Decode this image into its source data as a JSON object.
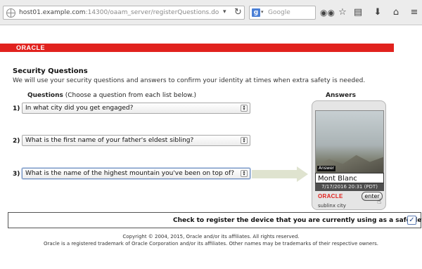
{
  "browser": {
    "url_host": "host01.example.com",
    "url_rest": ":14300/oaam_server/registerQuestions.do",
    "search_engine": "Google",
    "search_placeholder": "Google"
  },
  "header": {
    "logo_text": "ORACLE",
    "band_color": "#e1221e"
  },
  "page": {
    "title": "Security Questions",
    "subtitle": "We will use your security questions and answers to confirm your identity at times when extra safety is needed.",
    "questions_label": "Questions",
    "questions_hint": "(Choose a question from each list below.)",
    "answers_label": "Answers"
  },
  "questions": [
    {
      "number": "1)",
      "selected": "In what city did you get engaged?"
    },
    {
      "number": "2)",
      "selected": "What is the first name of your father's eldest sibling?"
    },
    {
      "number": "3)",
      "selected": "What is the name of the highest mountain you've been on top of?"
    }
  ],
  "device": {
    "answer_tag": "Answer",
    "answer_value": "Mont Blanc",
    "timestamp": "7/17/2016 20:31 (PDT)",
    "logo": "ORACLE",
    "enter_label": "enter",
    "caption": "sublinx city"
  },
  "register": {
    "label": "Check to register the device that you are currently using as a safe device:",
    "checked": true,
    "check_glyph": "✓"
  },
  "footer": {
    "copyright": "Copyright © 2004, 2015, Oracle and/or its affiliates. All rights reserved.",
    "trademark": "Oracle is a registered trademark of Oracle Corporation and/or its affiliates. Other names may be trademarks of their respective owners."
  }
}
